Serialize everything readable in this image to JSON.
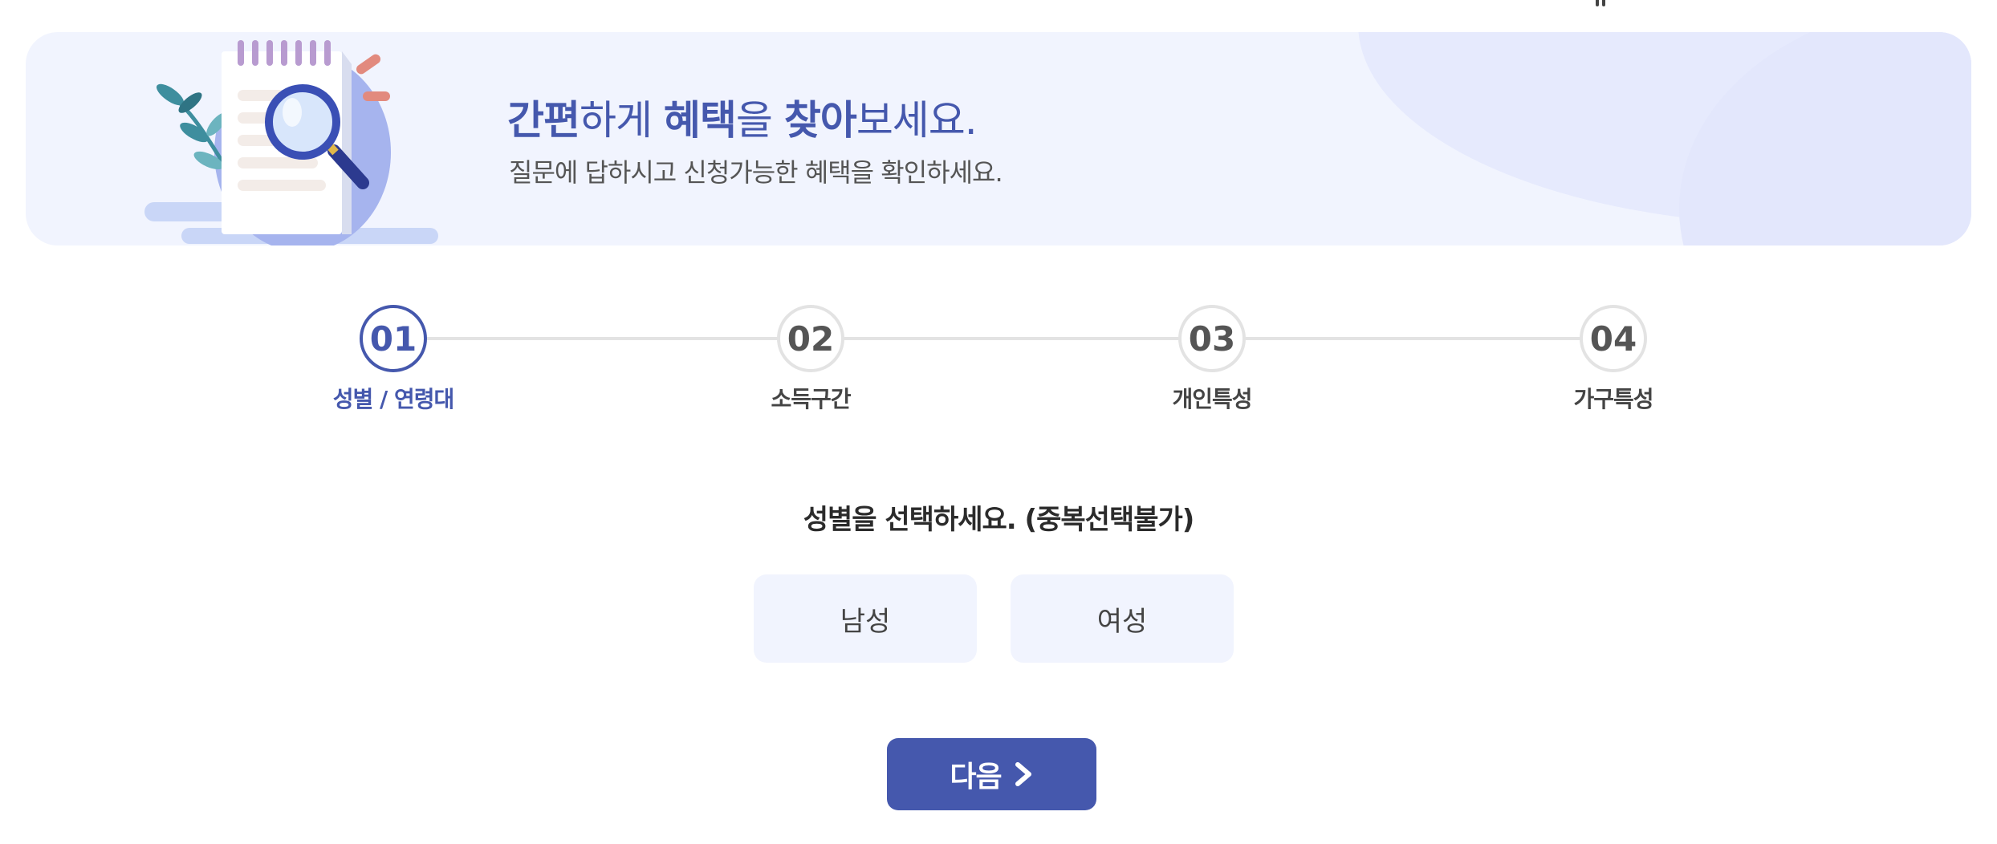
{
  "banner": {
    "title_parts": [
      {
        "text": "간편",
        "bold": true
      },
      {
        "text": "하게 ",
        "bold": false
      },
      {
        "text": "혜택",
        "bold": true
      },
      {
        "text": "을 ",
        "bold": false
      },
      {
        "text": "찾아",
        "bold": true
      },
      {
        "text": "보세요.",
        "bold": false
      }
    ],
    "subtitle": "질문에 답하시고 신청가능한 혜택을 확인하세요.",
    "illustration_icon": "document-magnifier-icon"
  },
  "steps": [
    {
      "number": "01",
      "label": "성별 / 연령대",
      "active": true
    },
    {
      "number": "02",
      "label": "소득구간",
      "active": false
    },
    {
      "number": "03",
      "label": "개인특성",
      "active": false
    },
    {
      "number": "04",
      "label": "가구특성",
      "active": false
    }
  ],
  "question": "성별을 선택하세요. (중복선택불가)",
  "options": [
    {
      "label": "남성"
    },
    {
      "label": "여성"
    }
  ],
  "next_button": {
    "label": "다음",
    "icon": "chevron-right-icon"
  },
  "colors": {
    "accent": "#4558ad",
    "banner_bg": "#f1f4fe",
    "option_bg": "#f1f4fe",
    "step_inactive_border": "#e3e3e3"
  }
}
